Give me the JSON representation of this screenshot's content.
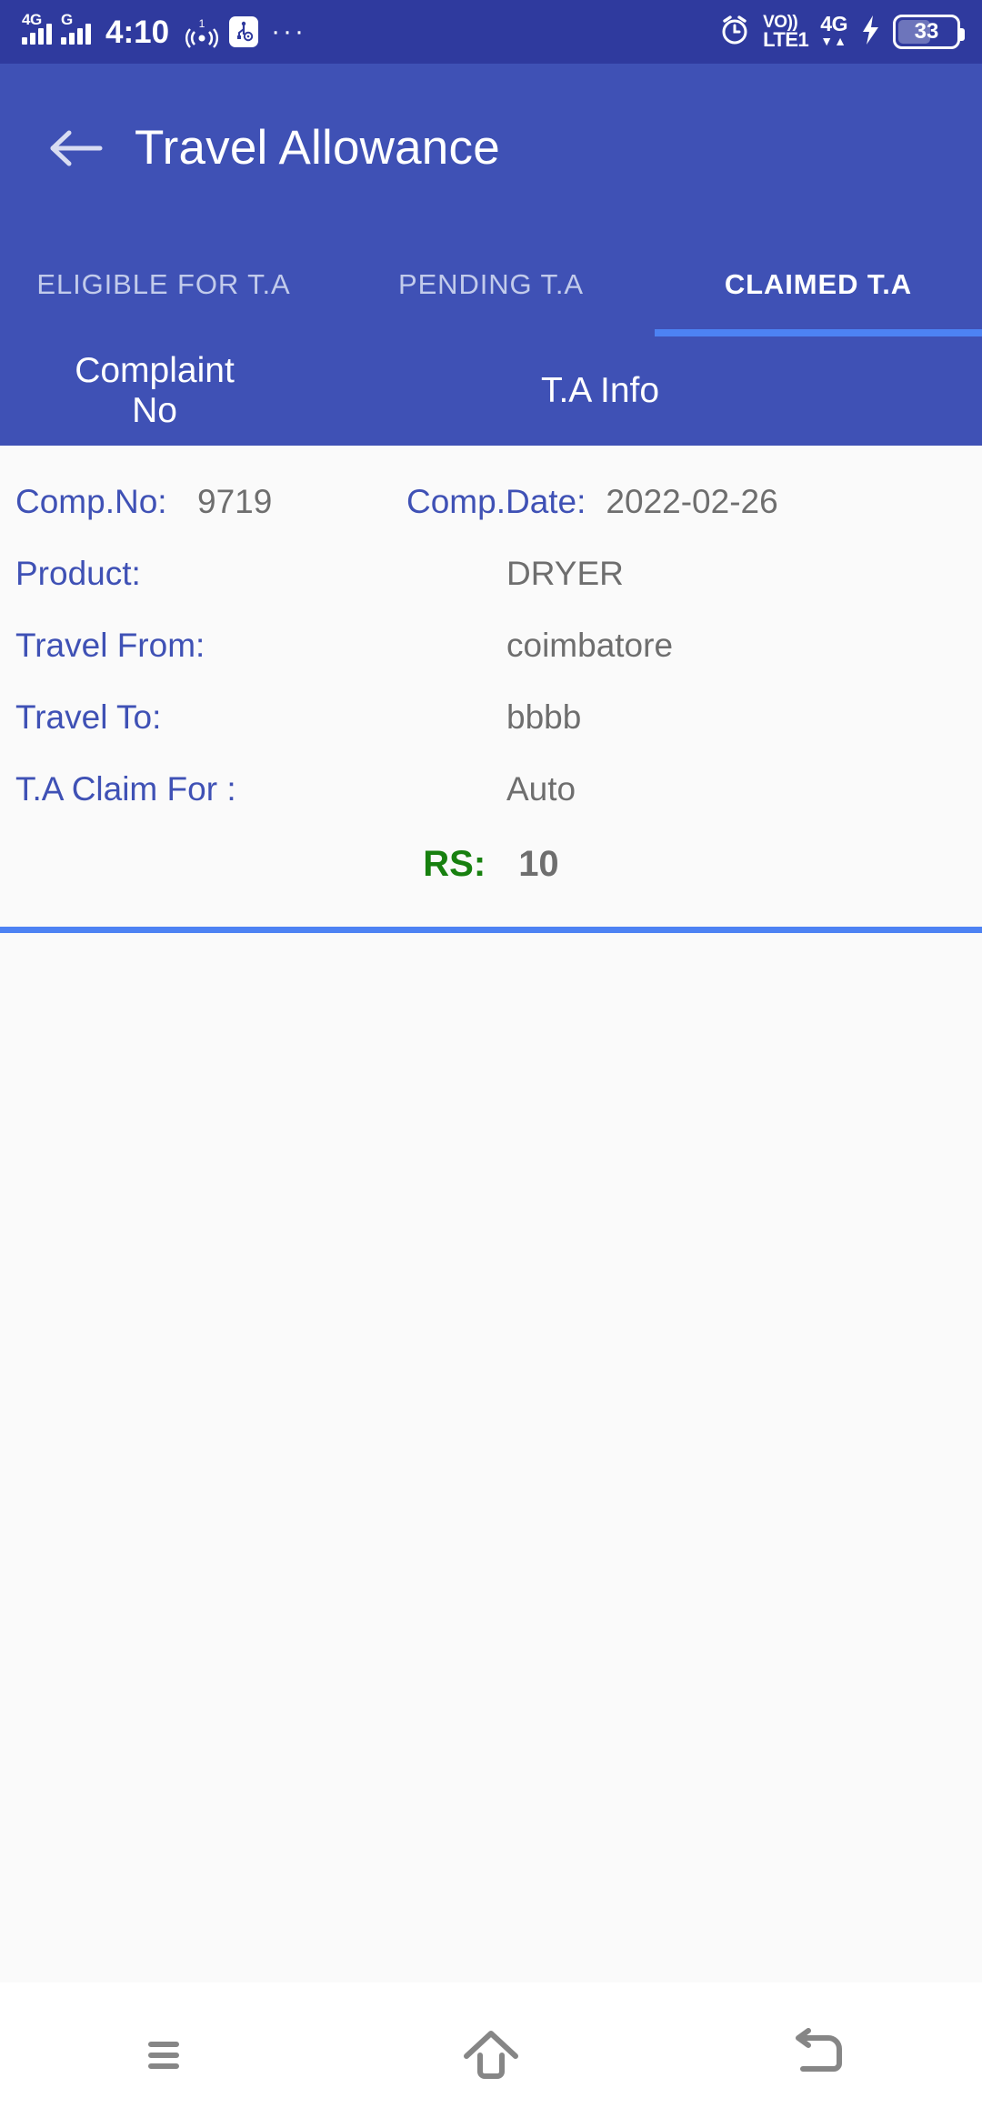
{
  "status_bar": {
    "network_primary": "4G",
    "network_secondary": "G",
    "time": "4:10",
    "hotspot_badge": "1",
    "overflow_dots": "···",
    "alarm_icon": "alarm-clock-icon",
    "volte_line1": "VO))",
    "volte_line2": "LTE1",
    "data_network": "4G",
    "data_network_sub": "1",
    "data_arrows": "▼▲",
    "charging_icon": "charging-bolt-icon",
    "battery_percent": "33",
    "bg_color": "#2f3a9e"
  },
  "app_bar": {
    "back_icon": "back-arrow-icon",
    "title": "Travel Allowance",
    "bg_color": "#3f51b5"
  },
  "tabs": {
    "items": [
      {
        "label": "ELIGIBLE FOR T.A",
        "active": false
      },
      {
        "label": "PENDING T.A",
        "active": false
      },
      {
        "label": "CLAIMED T.A",
        "active": true
      }
    ],
    "indicator_color": "#4d82f3"
  },
  "column_header": {
    "col1": "Complaint\nNo",
    "col1_line1": "Complaint",
    "col1_line2": "No",
    "col2": "T.A Info"
  },
  "record": {
    "comp_no_label": "Comp.No:",
    "comp_no_value": "9719",
    "comp_date_label": "Comp.Date:",
    "comp_date_value": "2022-02-26",
    "product_label": "Product:",
    "product_value": "DRYER",
    "travel_from_label": "Travel From:",
    "travel_from_value": "coimbatore",
    "travel_to_label": "Travel To:",
    "travel_to_value": "bbbb",
    "claim_for_label": "T.A Claim For :",
    "claim_for_value": "Auto",
    "amount_label": "RS:",
    "amount_value": "10",
    "amount_label_color": "#17800f",
    "label_color": "#3f51b5",
    "value_color": "#6e6e6e",
    "divider_color": "#4d82f3"
  },
  "nav_bar": {
    "recents_icon": "menu-recents-icon",
    "home_icon": "home-icon",
    "back_icon": "back-nav-icon",
    "icon_color": "#868686"
  }
}
